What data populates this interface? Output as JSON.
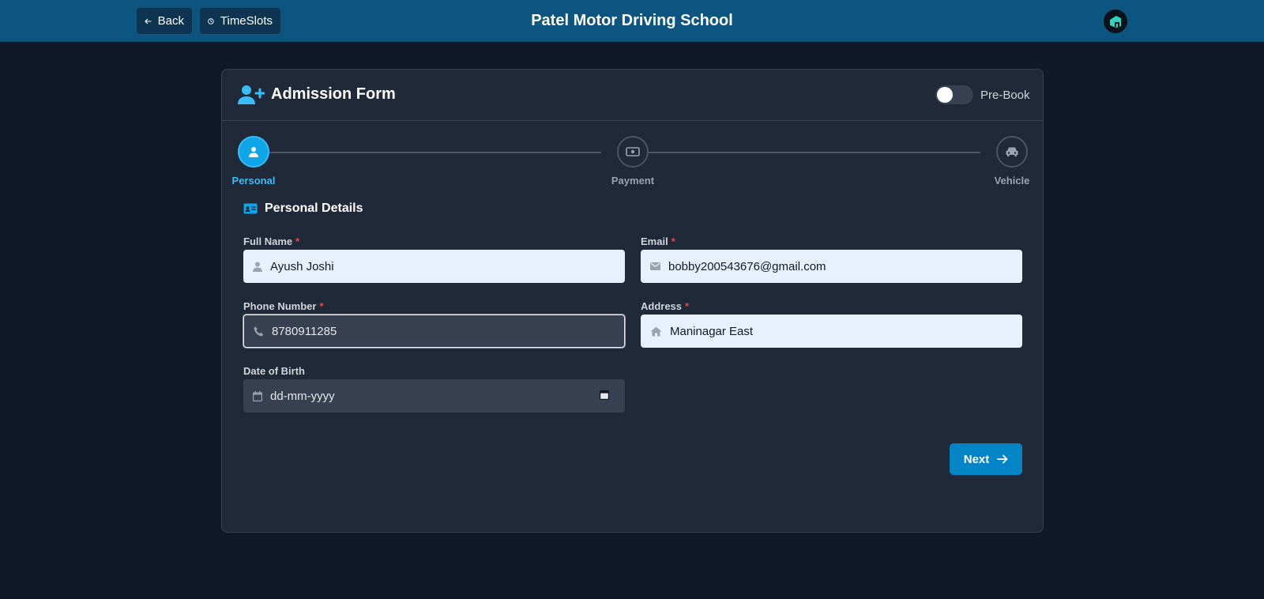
{
  "topbar": {
    "back_label": "Back",
    "timeslots_label": "TimeSlots",
    "title": "Patel Motor Driving School",
    "logo_icon": "building-logo-icon"
  },
  "card": {
    "title": "Admission Form",
    "prebook_label": "Pre-Book",
    "prebook_on": false
  },
  "steps": [
    {
      "label": "Personal",
      "icon": "user-icon",
      "active": true
    },
    {
      "label": "Payment",
      "icon": "money-icon",
      "active": false
    },
    {
      "label": "Vehicle",
      "icon": "car-icon",
      "active": false
    }
  ],
  "section": {
    "title": "Personal Details"
  },
  "form": {
    "full_name": {
      "label": "Full Name",
      "required": "*",
      "value": "Ayush Joshi"
    },
    "email": {
      "label": "Email",
      "required": "*",
      "value": "bobby200543676@gmail.com"
    },
    "phone": {
      "label": "Phone Number",
      "required": "*",
      "value": "8780911285"
    },
    "address": {
      "label": "Address",
      "required": "*",
      "value": "Maninagar East"
    },
    "dob": {
      "label": "Date of Birth",
      "value": "dd-mm-yyyy"
    }
  },
  "next_label": "Next",
  "colors": {
    "accent": "#0ea5e9",
    "background": "#111827",
    "card": "#1f2937",
    "topbar": "#0b5580",
    "required": "#ef4444"
  }
}
